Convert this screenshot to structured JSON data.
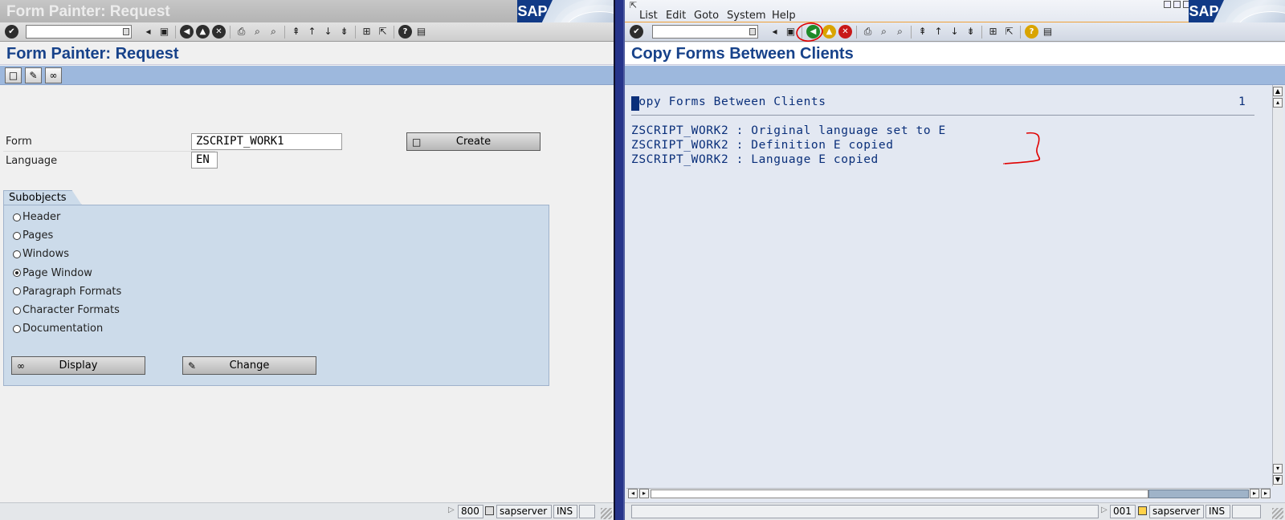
{
  "left": {
    "window_title": "Form Painter: Request",
    "page_title": "Form Painter: Request",
    "form_label": "Form",
    "form_value": "ZSCRIPT_WORK1",
    "language_label": "Language",
    "language_value": "EN",
    "create_button": "Create",
    "group_title": "Subobjects",
    "subobjects": [
      {
        "label": "Header",
        "selected": false
      },
      {
        "label": "Pages",
        "selected": false
      },
      {
        "label": "Windows",
        "selected": false
      },
      {
        "label": "Page Window",
        "selected": true
      },
      {
        "label": "Paragraph Formats",
        "selected": false
      },
      {
        "label": "Character Formats",
        "selected": false
      },
      {
        "label": "Documentation",
        "selected": false
      }
    ],
    "display_button": "Display",
    "change_button": "Change",
    "status": {
      "client": "800",
      "server": "sapserver",
      "mode": "INS"
    }
  },
  "right": {
    "menu": [
      "List",
      "Edit",
      "Goto",
      "System",
      "Help"
    ],
    "page_title": "Copy Forms Between Clients",
    "list_header": "Copy Forms Between Clients",
    "list_page": "1",
    "list_lines": [
      "ZSCRIPT_WORK2 : Original language set to E",
      "ZSCRIPT_WORK2 : Definition E copied",
      "ZSCRIPT_WORK2 : Language E copied"
    ],
    "status": {
      "client": "001",
      "server": "sapserver",
      "mode": "INS"
    }
  },
  "brand": {
    "logo_text": "SAP"
  },
  "colors": {
    "title_blue": "#17428a",
    "list_text": "#0a2f7a",
    "annotation_red": "#e00000",
    "group_bg": "#ccdbea",
    "appbar": "#9db8dd"
  }
}
